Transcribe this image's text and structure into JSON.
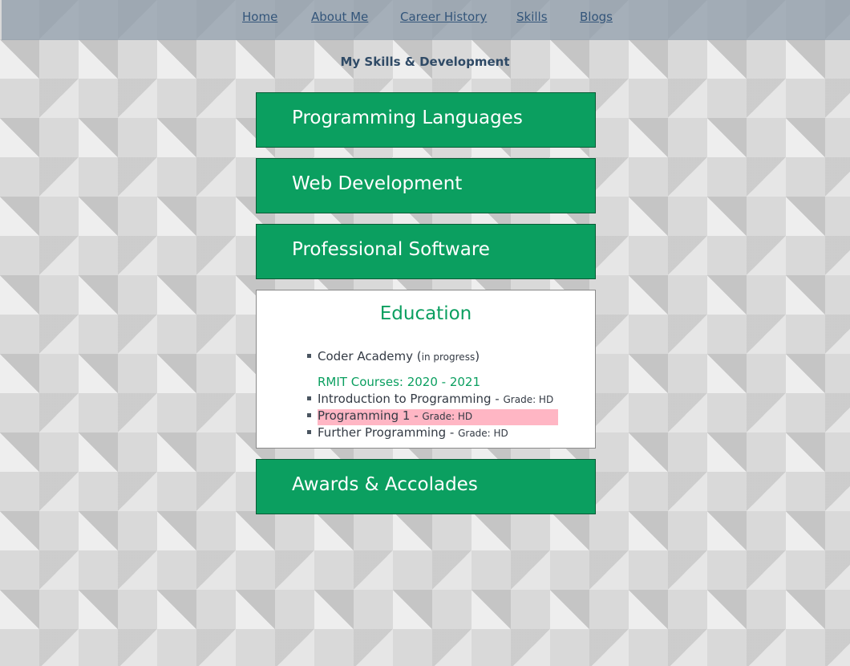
{
  "nav": {
    "home": "Home",
    "about": "About Me",
    "career": "Career History",
    "skills": "Skills",
    "blogs": "Blogs"
  },
  "page_title": "My Skills & Development",
  "panels": {
    "programming": "Programming Languages",
    "web": "Web Development",
    "software": "Professional Software",
    "awards": "Awards & Accolades"
  },
  "education": {
    "title": "Education",
    "coder": "Coder Academy (",
    "coder_note": "in progress",
    "coder_close": ")",
    "rmit_heading": "RMIT Courses: 2020 - 2021",
    "courses": [
      {
        "name": "Introduction to Programming",
        "sep": " - ",
        "grade": "Grade: HD"
      },
      {
        "name": "Programming 1",
        "sep": " - ",
        "grade": "Grade: HD"
      },
      {
        "name": "Further Programming",
        "sep": " - ",
        "grade": "Grade: HD"
      }
    ]
  },
  "colors": {
    "panel_green": "#0b9f60",
    "navbar": "#8c9aa8",
    "highlight": "#ffb6c4"
  }
}
